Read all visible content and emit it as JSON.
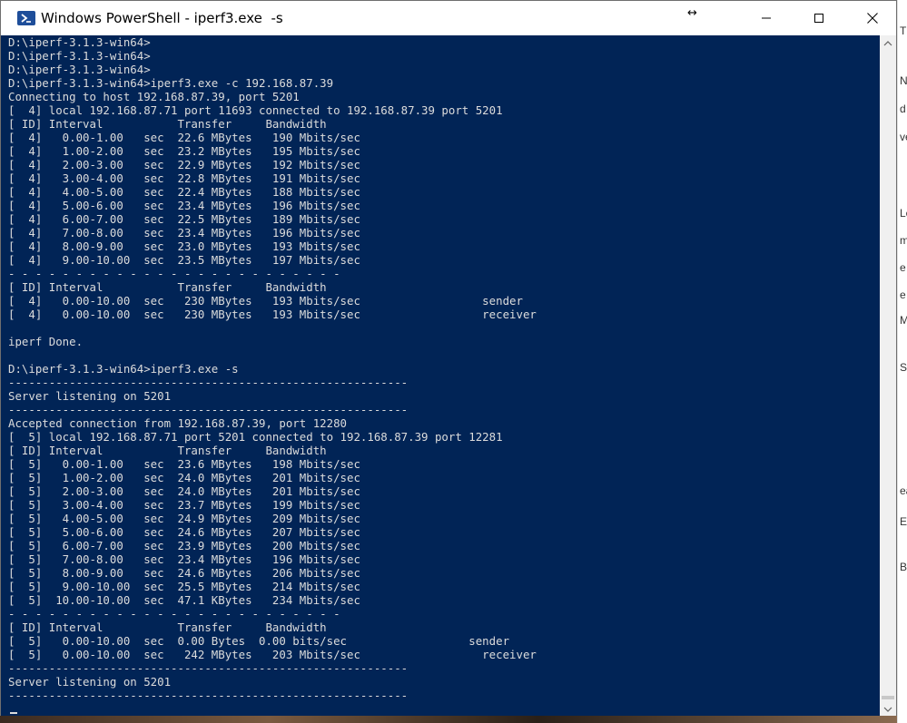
{
  "window": {
    "title": "Windows PowerShell - iperf3.exe  -s",
    "resize_glyph": "↔"
  },
  "console_lines": [
    "D:\\iperf-3.1.3-win64>",
    "D:\\iperf-3.1.3-win64>",
    "D:\\iperf-3.1.3-win64>",
    "D:\\iperf-3.1.3-win64>iperf3.exe -c 192.168.87.39",
    "Connecting to host 192.168.87.39, port 5201",
    "[  4] local 192.168.87.71 port 11693 connected to 192.168.87.39 port 5201",
    "[ ID] Interval           Transfer     Bandwidth",
    "[  4]   0.00-1.00   sec  22.6 MBytes   190 Mbits/sec",
    "[  4]   1.00-2.00   sec  23.2 MBytes   195 Mbits/sec",
    "[  4]   2.00-3.00   sec  22.9 MBytes   192 Mbits/sec",
    "[  4]   3.00-4.00   sec  22.8 MBytes   191 Mbits/sec",
    "[  4]   4.00-5.00   sec  22.4 MBytes   188 Mbits/sec",
    "[  4]   5.00-6.00   sec  23.4 MBytes   196 Mbits/sec",
    "[  4]   6.00-7.00   sec  22.5 MBytes   189 Mbits/sec",
    "[  4]   7.00-8.00   sec  23.4 MBytes   196 Mbits/sec",
    "[  4]   8.00-9.00   sec  23.0 MBytes   193 Mbits/sec",
    "[  4]   9.00-10.00  sec  23.5 MBytes   197 Mbits/sec",
    "- - - - - - - - - - - - - - - - - - - - - - - - -",
    "[ ID] Interval           Transfer     Bandwidth",
    "[  4]   0.00-10.00  sec   230 MBytes   193 Mbits/sec                  sender",
    "[  4]   0.00-10.00  sec   230 MBytes   193 Mbits/sec                  receiver",
    "",
    "iperf Done.",
    "",
    "D:\\iperf-3.1.3-win64>iperf3.exe -s",
    "-----------------------------------------------------------",
    "Server listening on 5201",
    "-----------------------------------------------------------",
    "Accepted connection from 192.168.87.39, port 12280",
    "[  5] local 192.168.87.71 port 5201 connected to 192.168.87.39 port 12281",
    "[ ID] Interval           Transfer     Bandwidth",
    "[  5]   0.00-1.00   sec  23.6 MBytes   198 Mbits/sec",
    "[  5]   1.00-2.00   sec  24.0 MBytes   201 Mbits/sec",
    "[  5]   2.00-3.00   sec  24.0 MBytes   201 Mbits/sec",
    "[  5]   3.00-4.00   sec  23.7 MBytes   199 Mbits/sec",
    "[  5]   4.00-5.00   sec  24.9 MBytes   209 Mbits/sec",
    "[  5]   5.00-6.00   sec  24.6 MBytes   207 Mbits/sec",
    "[  5]   6.00-7.00   sec  23.9 MBytes   200 Mbits/sec",
    "[  5]   7.00-8.00   sec  23.4 MBytes   196 Mbits/sec",
    "[  5]   8.00-9.00   sec  24.6 MBytes   206 Mbits/sec",
    "[  5]   9.00-10.00  sec  25.5 MBytes   214 Mbits/sec",
    "[  5]  10.00-10.00  sec  47.1 KBytes   234 Mbits/sec",
    "- - - - - - - - - - - - - - - - - - - - - - - - -",
    "[ ID] Interval           Transfer     Bandwidth",
    "[  5]   0.00-10.00  sec  0.00 Bytes  0.00 bits/sec                  sender",
    "[  5]   0.00-10.00  sec   242 MBytes   203 Mbits/sec                  receiver",
    "-----------------------------------------------------------",
    "Server listening on 5201",
    "-----------------------------------------------------------"
  ],
  "side_glyphs": [
    "T",
    "N",
    "d",
    "ve",
    "Le",
    "m",
    "e",
    "e",
    "M",
    "St",
    "ea",
    "E",
    "Bi"
  ],
  "colors": {
    "console_bg": "#012456",
    "console_fg": "#dcdcdc",
    "titlebar_bg": "#ffffff"
  }
}
